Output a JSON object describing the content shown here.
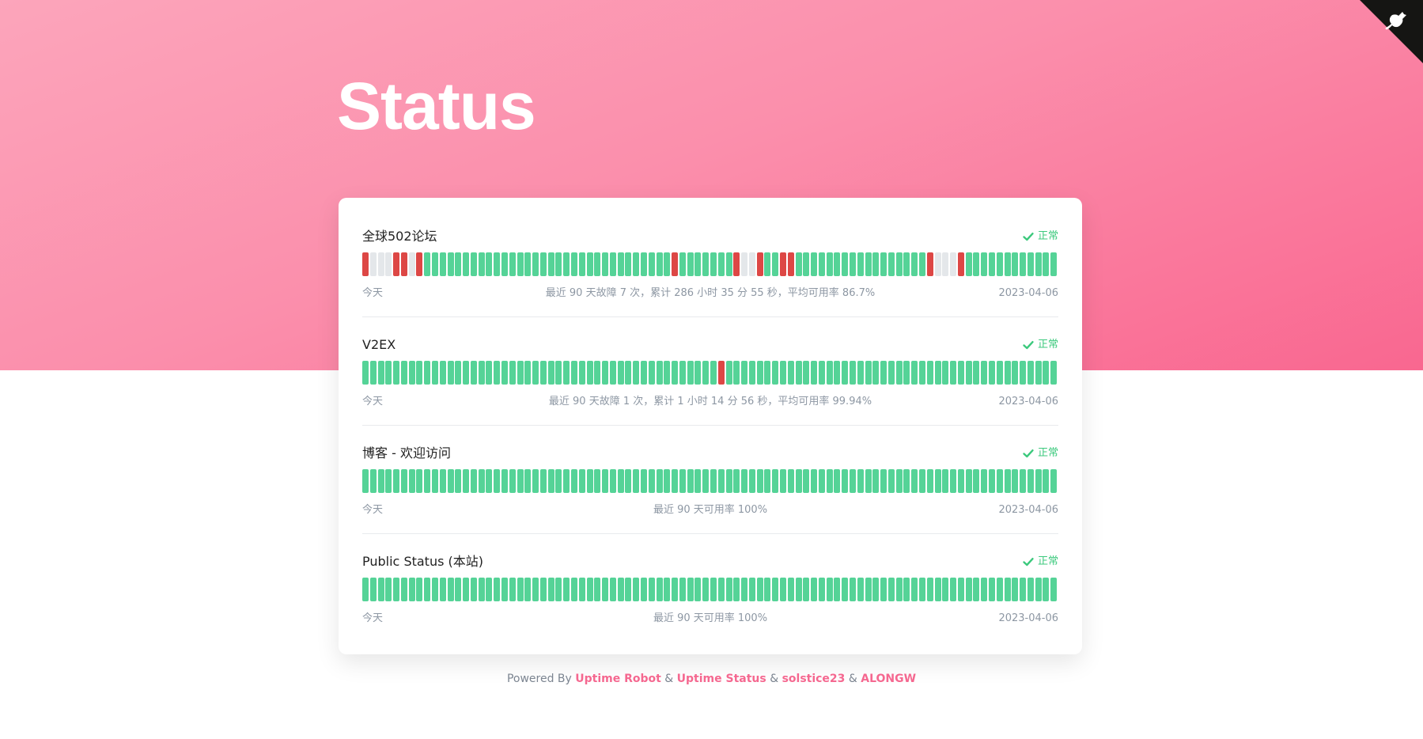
{
  "page": {
    "title": "Status"
  },
  "corner_icon": "github-corner-icon",
  "colors": {
    "ok": "#55d397",
    "down": "#dd4745",
    "none": "#e4e7ea",
    "accent": "#f56890",
    "status_ok": "#3cc97d"
  },
  "monitors": [
    {
      "name": "全球502论坛",
      "status": "正常",
      "start_label": "今天",
      "summary": "最近 90 天故障 7 次，累计 286 小时 35 分 55 秒，平均可用率 86.7%",
      "end_label": "2023-04-06",
      "days": [
        "down",
        "none",
        "none",
        "none",
        "down",
        "down",
        "none",
        "down",
        "ok",
        "ok",
        "ok",
        "ok",
        "ok",
        "ok",
        "ok",
        "ok",
        "ok",
        "ok",
        "ok",
        "ok",
        "ok",
        "ok",
        "ok",
        "ok",
        "ok",
        "ok",
        "ok",
        "ok",
        "ok",
        "ok",
        "ok",
        "ok",
        "ok",
        "ok",
        "ok",
        "ok",
        "ok",
        "ok",
        "ok",
        "ok",
        "down",
        "ok",
        "ok",
        "ok",
        "ok",
        "ok",
        "ok",
        "ok",
        "down",
        "none",
        "none",
        "down",
        "ok",
        "ok",
        "down",
        "down",
        "ok",
        "ok",
        "ok",
        "ok",
        "ok",
        "ok",
        "ok",
        "ok",
        "ok",
        "ok",
        "ok",
        "ok",
        "ok",
        "ok",
        "ok",
        "ok",
        "ok",
        "down",
        "none",
        "none",
        "none",
        "down",
        "ok",
        "ok",
        "ok",
        "ok",
        "ok",
        "ok",
        "ok",
        "ok",
        "ok",
        "ok",
        "ok",
        "ok"
      ]
    },
    {
      "name": "V2EX",
      "status": "正常",
      "start_label": "今天",
      "summary": "最近 90 天故障 1 次，累计 1 小时 14 分 56 秒，平均可用率 99.94%",
      "end_label": "2023-04-06",
      "days": [
        "ok",
        "ok",
        "ok",
        "ok",
        "ok",
        "ok",
        "ok",
        "ok",
        "ok",
        "ok",
        "ok",
        "ok",
        "ok",
        "ok",
        "ok",
        "ok",
        "ok",
        "ok",
        "ok",
        "ok",
        "ok",
        "ok",
        "ok",
        "ok",
        "ok",
        "ok",
        "ok",
        "ok",
        "ok",
        "ok",
        "ok",
        "ok",
        "ok",
        "ok",
        "ok",
        "ok",
        "ok",
        "ok",
        "ok",
        "ok",
        "ok",
        "ok",
        "ok",
        "ok",
        "ok",
        "ok",
        "down",
        "ok",
        "ok",
        "ok",
        "ok",
        "ok",
        "ok",
        "ok",
        "ok",
        "ok",
        "ok",
        "ok",
        "ok",
        "ok",
        "ok",
        "ok",
        "ok",
        "ok",
        "ok",
        "ok",
        "ok",
        "ok",
        "ok",
        "ok",
        "ok",
        "ok",
        "ok",
        "ok",
        "ok",
        "ok",
        "ok",
        "ok",
        "ok",
        "ok",
        "ok",
        "ok",
        "ok",
        "ok",
        "ok",
        "ok",
        "ok",
        "ok",
        "ok",
        "ok"
      ]
    },
    {
      "name": "博客 - 欢迎访问",
      "status": "正常",
      "start_label": "今天",
      "summary": "最近 90 天可用率 100%",
      "end_label": "2023-04-06",
      "days": [
        "ok",
        "ok",
        "ok",
        "ok",
        "ok",
        "ok",
        "ok",
        "ok",
        "ok",
        "ok",
        "ok",
        "ok",
        "ok",
        "ok",
        "ok",
        "ok",
        "ok",
        "ok",
        "ok",
        "ok",
        "ok",
        "ok",
        "ok",
        "ok",
        "ok",
        "ok",
        "ok",
        "ok",
        "ok",
        "ok",
        "ok",
        "ok",
        "ok",
        "ok",
        "ok",
        "ok",
        "ok",
        "ok",
        "ok",
        "ok",
        "ok",
        "ok",
        "ok",
        "ok",
        "ok",
        "ok",
        "ok",
        "ok",
        "ok",
        "ok",
        "ok",
        "ok",
        "ok",
        "ok",
        "ok",
        "ok",
        "ok",
        "ok",
        "ok",
        "ok",
        "ok",
        "ok",
        "ok",
        "ok",
        "ok",
        "ok",
        "ok",
        "ok",
        "ok",
        "ok",
        "ok",
        "ok",
        "ok",
        "ok",
        "ok",
        "ok",
        "ok",
        "ok",
        "ok",
        "ok",
        "ok",
        "ok",
        "ok",
        "ok",
        "ok",
        "ok",
        "ok",
        "ok",
        "ok",
        "ok"
      ]
    },
    {
      "name": "Public Status (本站)",
      "status": "正常",
      "start_label": "今天",
      "summary": "最近 90 天可用率 100%",
      "end_label": "2023-04-06",
      "days": [
        "ok",
        "ok",
        "ok",
        "ok",
        "ok",
        "ok",
        "ok",
        "ok",
        "ok",
        "ok",
        "ok",
        "ok",
        "ok",
        "ok",
        "ok",
        "ok",
        "ok",
        "ok",
        "ok",
        "ok",
        "ok",
        "ok",
        "ok",
        "ok",
        "ok",
        "ok",
        "ok",
        "ok",
        "ok",
        "ok",
        "ok",
        "ok",
        "ok",
        "ok",
        "ok",
        "ok",
        "ok",
        "ok",
        "ok",
        "ok",
        "ok",
        "ok",
        "ok",
        "ok",
        "ok",
        "ok",
        "ok",
        "ok",
        "ok",
        "ok",
        "ok",
        "ok",
        "ok",
        "ok",
        "ok",
        "ok",
        "ok",
        "ok",
        "ok",
        "ok",
        "ok",
        "ok",
        "ok",
        "ok",
        "ok",
        "ok",
        "ok",
        "ok",
        "ok",
        "ok",
        "ok",
        "ok",
        "ok",
        "ok",
        "ok",
        "ok",
        "ok",
        "ok",
        "ok",
        "ok",
        "ok",
        "ok",
        "ok",
        "ok",
        "ok",
        "ok",
        "ok",
        "ok",
        "ok",
        "ok"
      ]
    }
  ],
  "footer": {
    "prefix": "Powered By",
    "amp": "&",
    "links": [
      "Uptime Robot",
      "Uptime Status",
      "solstice23",
      "ALONGW"
    ]
  }
}
